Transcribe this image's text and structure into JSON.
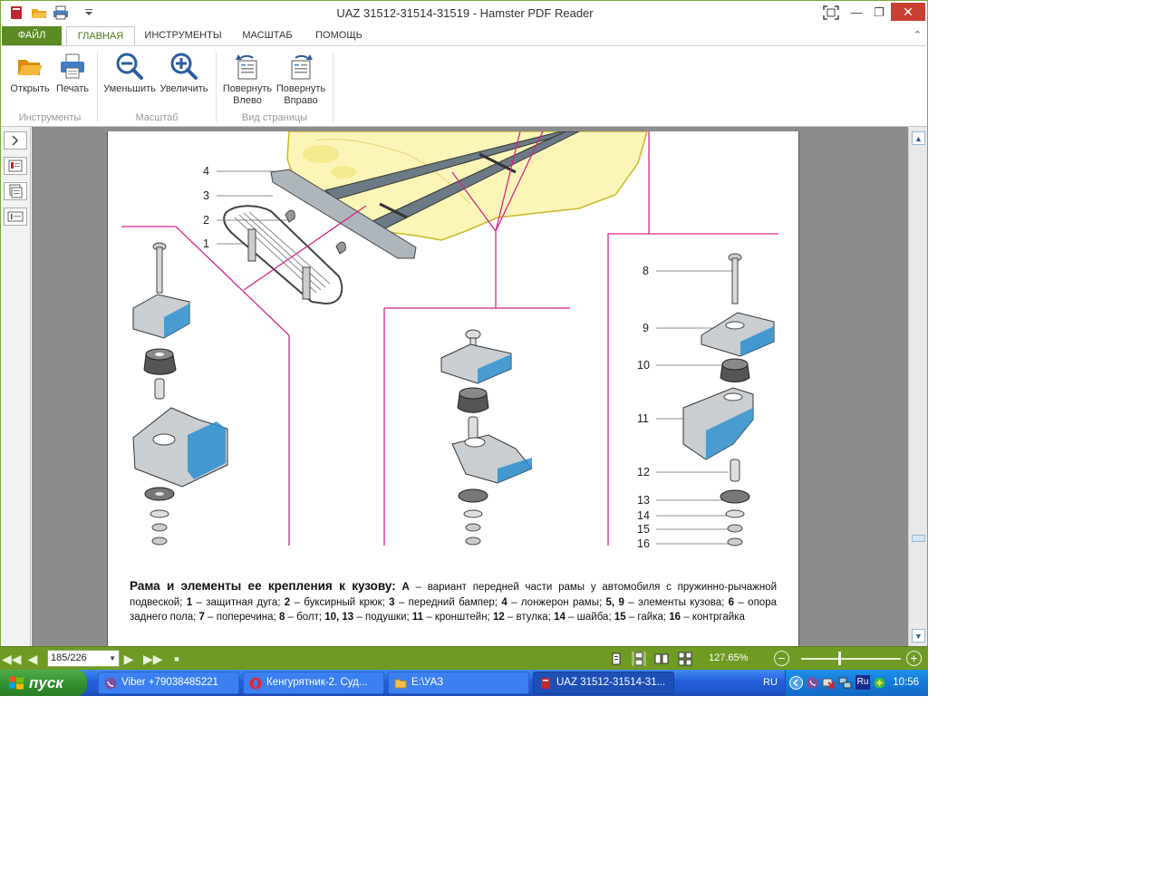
{
  "window": {
    "title": "UAZ 31512-31514-31519  - Hamster PDF Reader"
  },
  "tabs": {
    "file": "ФАЙЛ",
    "items": [
      "ГЛАВНАЯ",
      "ИНСТРУМЕНТЫ",
      "МАСШТАБ",
      "ПОМОЩЬ"
    ],
    "active": "ГЛАВНАЯ"
  },
  "ribbon": {
    "open": "Открыть",
    "print": "Печать",
    "zoom_out": "Уменьшить",
    "zoom_in": "Увеличить",
    "rotate_left_1": "Повернуть",
    "rotate_left_2": "Влево",
    "rotate_right_1": "Повернуть",
    "rotate_right_2": "Вправо",
    "group_tools": "Инструменты",
    "group_scale": "Масштаб",
    "group_view": "Вид страницы"
  },
  "figure": {
    "callouts_left": [
      "4",
      "3",
      "2",
      "1"
    ],
    "callouts_right": [
      "8",
      "9",
      "10",
      "11",
      "12",
      "13",
      "14",
      "15",
      "16"
    ]
  },
  "caption": {
    "title": "Рама и элементы ее крепления к кузову:",
    "t_a": "А",
    "s1": " – вариант передней части рамы у автомобиля с пружинно-рычажной подвеской; ",
    "n1": "1",
    "s2": " – защитная дуга; ",
    "n2": "2",
    "s3": " – буксирный крюк; ",
    "n3": "3",
    "s4": " – передний бампер; ",
    "n4": "4",
    "s5": " – лонжерон рамы; ",
    "n5": "5, 9",
    "s6": " – элементы кузова; ",
    "n6": "6",
    "s7": " – опора заднего пола; ",
    "n7": "7",
    "s8": " – поперечина; ",
    "n8": "8",
    "s9": " – болт; ",
    "n9": "10, 13",
    "s10": " – подушки; ",
    "n10": "11",
    "s11": " – кронштейн; ",
    "n11": "12",
    "s12": " – втулка; ",
    "n12": "14",
    "s13": " – шайба; ",
    "n13": "15",
    "s14": " – гайка; ",
    "n14": "16",
    "s15": " – контргайка"
  },
  "status": {
    "page": "185/226",
    "zoom": "127.65%"
  },
  "taskbar": {
    "start": "пуск",
    "tasks": [
      "Viber +79038485221",
      "Кенгурятник-2. Суд...",
      "E:\\УАЗ",
      "UAZ 31512-31514-31..."
    ],
    "lang": "RU",
    "clock": "10:56",
    "tray_ru": "Ru"
  },
  "colors": {
    "accent_green": "#6f9a24",
    "tab_green": "#5c8a24",
    "callout_magenta": "#d4268a",
    "xp_blue": "#235ed9",
    "start_green": "#318f2d",
    "close_red": "#c84031"
  }
}
